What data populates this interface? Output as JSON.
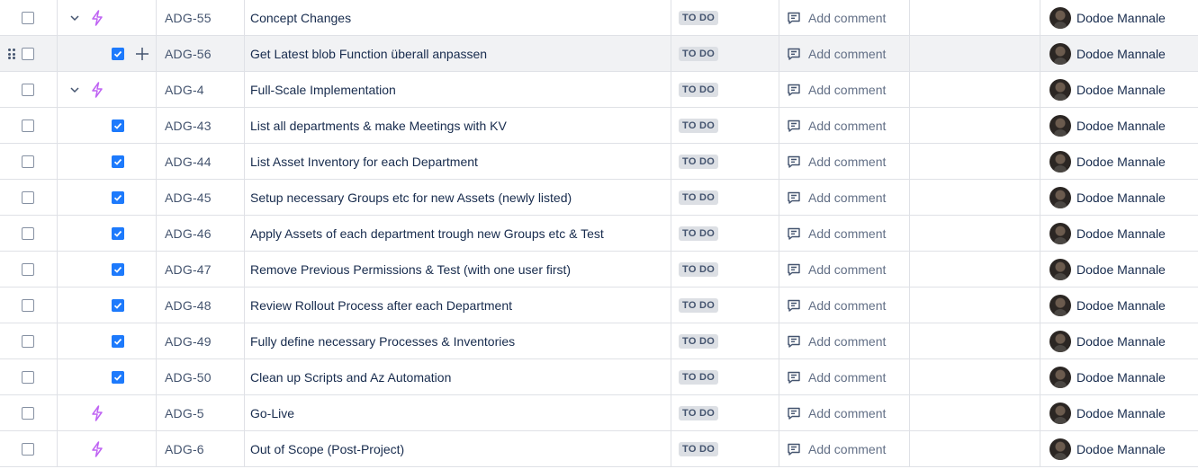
{
  "colors": {
    "epic": "#bf63f3",
    "subtask": "#1d7afc",
    "border": "#dfe1e6",
    "lozenge_bg": "#dcdfe4"
  },
  "rows": [
    {
      "key": "ADG-55",
      "summary": "Concept Changes",
      "status": "TO DO",
      "comment": "Add comment",
      "assignee": "Dodoe Mannale",
      "level": "epic",
      "expanded": true
    },
    {
      "key": "ADG-56",
      "summary": "Get Latest blob Function überall anpassen",
      "status": "TO DO",
      "comment": "Add comment",
      "assignee": "Dodoe Mannale",
      "level": "subtask",
      "hovered": true
    },
    {
      "key": "ADG-4",
      "summary": "Full-Scale Implementation",
      "status": "TO DO",
      "comment": "Add comment",
      "assignee": "Dodoe Mannale",
      "level": "epic",
      "expanded": true
    },
    {
      "key": "ADG-43",
      "summary": "List all departments & make Meetings with KV",
      "status": "TO DO",
      "comment": "Add comment",
      "assignee": "Dodoe Mannale",
      "level": "subtask"
    },
    {
      "key": "ADG-44",
      "summary": "List Asset Inventory for each Department",
      "status": "TO DO",
      "comment": "Add comment",
      "assignee": "Dodoe Mannale",
      "level": "subtask"
    },
    {
      "key": "ADG-45",
      "summary": "Setup necessary Groups etc for new Assets (newly listed)",
      "status": "TO DO",
      "comment": "Add comment",
      "assignee": "Dodoe Mannale",
      "level": "subtask"
    },
    {
      "key": "ADG-46",
      "summary": "Apply Assets of each department trough new Groups etc & Test",
      "status": "TO DO",
      "comment": "Add comment",
      "assignee": "Dodoe Mannale",
      "level": "subtask"
    },
    {
      "key": "ADG-47",
      "summary": "Remove Previous Permissions & Test (with one user first)",
      "status": "TO DO",
      "comment": "Add comment",
      "assignee": "Dodoe Mannale",
      "level": "subtask"
    },
    {
      "key": "ADG-48",
      "summary": "Review Rollout Process after each Department",
      "status": "TO DO",
      "comment": "Add comment",
      "assignee": "Dodoe Mannale",
      "level": "subtask"
    },
    {
      "key": "ADG-49",
      "summary": "Fully define necessary Processes & Inventories",
      "status": "TO DO",
      "comment": "Add comment",
      "assignee": "Dodoe Mannale",
      "level": "subtask"
    },
    {
      "key": "ADG-50",
      "summary": "Clean up Scripts and Az Automation",
      "status": "TO DO",
      "comment": "Add comment",
      "assignee": "Dodoe Mannale",
      "level": "subtask"
    },
    {
      "key": "ADG-5",
      "summary": "Go-Live",
      "status": "TO DO",
      "comment": "Add comment",
      "assignee": "Dodoe Mannale",
      "level": "epic",
      "expanded": false
    },
    {
      "key": "ADG-6",
      "summary": "Out of Scope (Post-Project)",
      "status": "TO DO",
      "comment": "Add comment",
      "assignee": "Dodoe Mannale",
      "level": "epic",
      "expanded": false
    }
  ]
}
